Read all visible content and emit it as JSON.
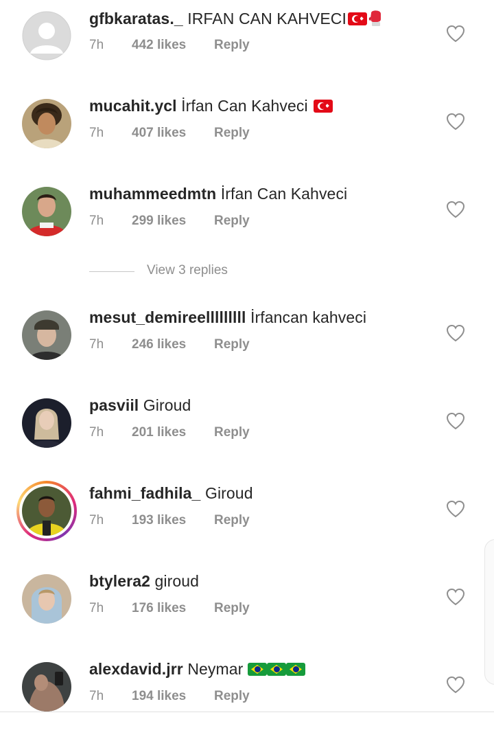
{
  "comments": [
    {
      "username": "gfbkaratas._",
      "text": "IRFAN CAN KAHVECI",
      "time": "7h",
      "likes": "442 likes",
      "reply": "Reply",
      "emoji": [
        "tr-flag",
        "boxing-glove"
      ]
    },
    {
      "username": "mucahit.ycl",
      "text": "İrfan Can Kahveci",
      "time": "7h",
      "likes": "407 likes",
      "reply": "Reply",
      "emoji": [
        "tr-flag"
      ]
    },
    {
      "username": "muhammeedmtn",
      "text": "İrfan Can Kahveci",
      "time": "7h",
      "likes": "299 likes",
      "reply": "Reply",
      "emoji": []
    },
    {
      "username": "mesut_demireelllllllll",
      "text": "İrfancan kahveci",
      "time": "7h",
      "likes": "246 likes",
      "reply": "Reply",
      "emoji": []
    },
    {
      "username": "pasviil",
      "text": "Giroud",
      "time": "7h",
      "likes": "201 likes",
      "reply": "Reply",
      "emoji": []
    },
    {
      "username": "fahmi_fadhila_",
      "text": "Giroud",
      "time": "7h",
      "likes": "193 likes",
      "reply": "Reply",
      "emoji": []
    },
    {
      "username": "btylera2",
      "text": "giroud",
      "time": "7h",
      "likes": "176 likes",
      "reply": "Reply",
      "emoji": []
    },
    {
      "username": "alexdavid.jrr",
      "text": "Neymar",
      "time": "7h",
      "likes": "194 likes",
      "reply": "Reply",
      "emoji": [
        "br-flag",
        "br-flag",
        "br-flag"
      ]
    }
  ],
  "view_replies": "View 3 replies",
  "icons": {
    "like": "heart-outline-icon",
    "default_avatar": "default-avatar-icon"
  },
  "colors": {
    "text": "#262626",
    "meta": "#8e8e8e",
    "story_ring": "#dd2a7b"
  }
}
